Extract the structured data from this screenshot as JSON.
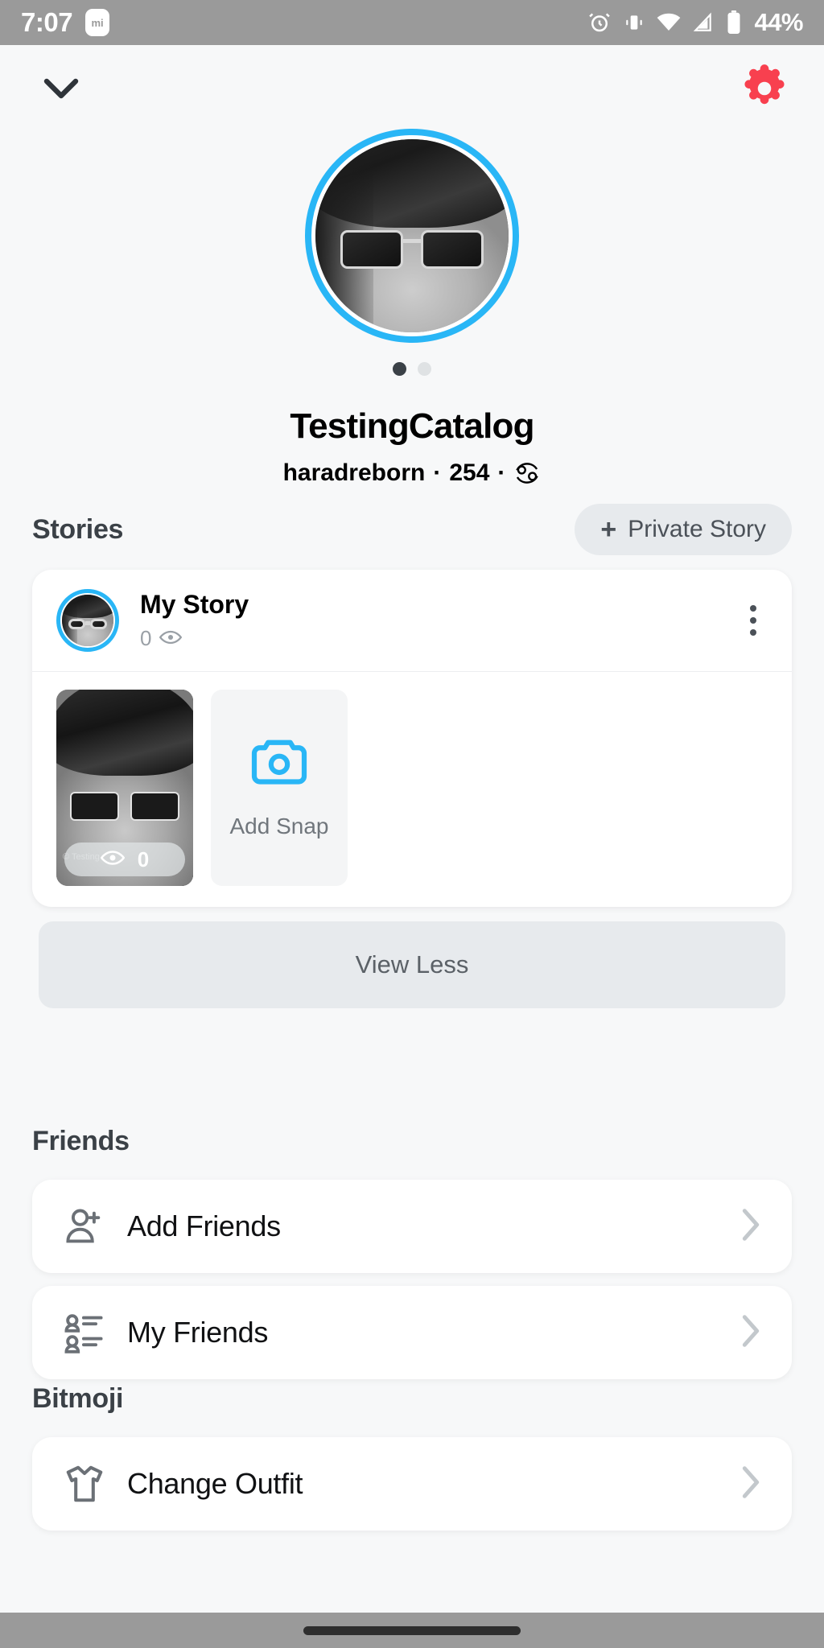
{
  "status_bar": {
    "time": "7:07",
    "app_icon_label": "mi",
    "battery_percent": "44%",
    "icons": [
      "alarm-icon",
      "vibrate-icon",
      "wifi-icon",
      "signal-icon",
      "battery-icon"
    ],
    "background_color": "#9a9a9a"
  },
  "top_nav": {
    "back_icon": "chevron-down-icon",
    "settings_icon": "gear-icon",
    "settings_color": "#f8404f"
  },
  "profile": {
    "avatar_ring_color": "#29b6f6",
    "display_name": "TestingCatalog",
    "username": "haradreborn",
    "score": "254",
    "zodiac": "Cancer",
    "separator": "·",
    "page_dots": {
      "count": 2,
      "active_index": 0
    }
  },
  "stories": {
    "section_title": "Stories",
    "private_story_button": {
      "label": "Private Story",
      "plus": "+"
    },
    "my_story": {
      "title": "My Story",
      "views": "0",
      "views_icon": "eye-icon",
      "menu_icon": "kebab-menu-icon"
    },
    "snap": {
      "view_count": "0",
      "view_icon": "eye-icon",
      "watermark": "© Testing"
    },
    "add_snap": {
      "label": "Add Snap",
      "icon": "camera-icon",
      "icon_color": "#29b6f6"
    },
    "view_less_button": "View Less"
  },
  "friends": {
    "section_title": "Friends",
    "items": [
      {
        "label": "Add Friends",
        "icon": "person-add-icon",
        "chevron": "chevron-right-icon"
      },
      {
        "label": "My Friends",
        "icon": "people-list-icon",
        "chevron": "chevron-right-icon"
      }
    ]
  },
  "bitmoji": {
    "section_title": "Bitmoji",
    "items": [
      {
        "label": "Change Outfit",
        "icon": "shirt-icon",
        "chevron": "chevron-right-icon"
      }
    ]
  }
}
